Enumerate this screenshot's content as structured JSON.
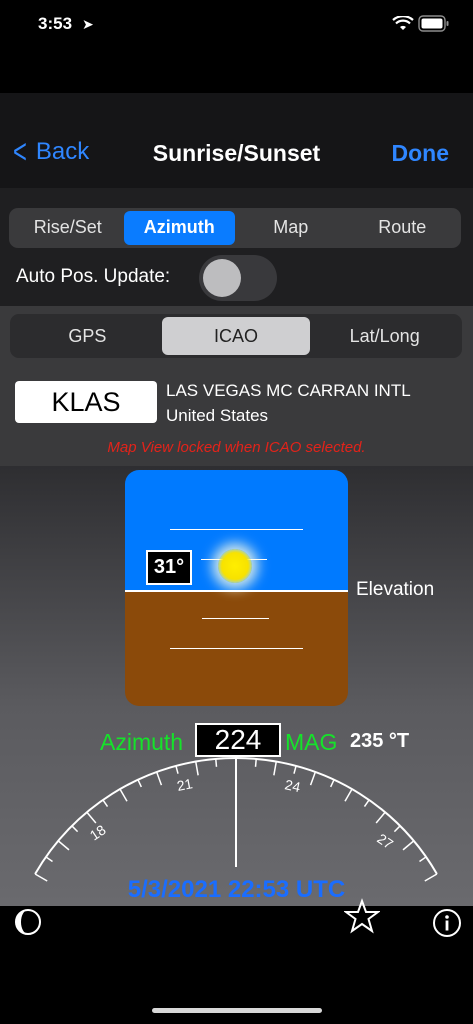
{
  "status": {
    "time": "3:53"
  },
  "nav": {
    "back": "Back",
    "title": "Sunrise/Sunset",
    "done": "Done"
  },
  "tabs": [
    {
      "label": "Rise/Set",
      "active": false
    },
    {
      "label": "Azimuth",
      "active": true
    },
    {
      "label": "Map",
      "active": false
    },
    {
      "label": "Route",
      "active": false
    }
  ],
  "auto_update": {
    "label": "Auto Pos. Update:",
    "on": false
  },
  "source_tabs": [
    {
      "label": "GPS",
      "active": false
    },
    {
      "label": "ICAO",
      "active": true
    },
    {
      "label": "Lat/Long",
      "active": false
    }
  ],
  "icao": {
    "code": "KLAS",
    "name": "LAS VEGAS MC CARRAN INTL",
    "country": "United States"
  },
  "lock_message": "Map View locked when ICAO selected.",
  "elevation": {
    "value": "31°",
    "label": "Elevation"
  },
  "azimuth": {
    "label": "Azimuth",
    "value": "224",
    "mag_label": "MAG",
    "true_value": "235 °T"
  },
  "compass_labels": [
    "18",
    "21",
    "24",
    "27"
  ],
  "datetime": "5/3/2021 22:53 UTC",
  "colors": {
    "accent": "#2f86ff",
    "green": "#15e32a",
    "sky": "#007aff",
    "ground": "#8b4a0a",
    "warning": "#e2231a"
  },
  "icons": {
    "back": "chevron-left-icon",
    "night": "moon-half-icon",
    "favorite": "star-icon",
    "info": "info-icon"
  }
}
